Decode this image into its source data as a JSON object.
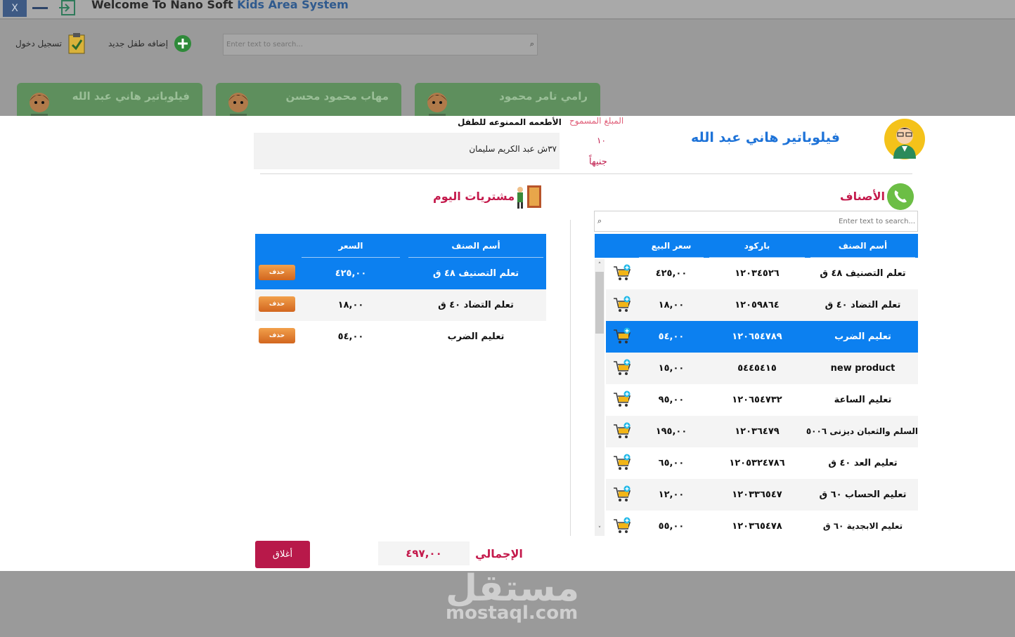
{
  "window": {
    "close_label": "X",
    "title_prefix": "Welcome To Nano Soft",
    "title_accent": "Kids Area System"
  },
  "toolbar": {
    "login_label": "تسجيل دخول",
    "add_child_label": "إضافه طفل جديد",
    "search_placeholder": "Enter text to search..."
  },
  "children_cards": [
    {
      "name": "فيلوباتير هاني عبد الله"
    },
    {
      "name": "مهاب محمود محسن"
    },
    {
      "name": "رامي تامر محمود"
    }
  ],
  "modal": {
    "child_name": "فيلوباتير  هاني عبد الله",
    "allowed_amount_label": "المبلغ المسموح",
    "allowed_amount_value": "١٠",
    "allowed_amount_currency": "جنيهاً",
    "forbidden_food_title": "الأطعمه الممنوعه للطفل",
    "forbidden_food_text": "٣٧ش عبد الكريم سليمان",
    "categories_title": "الأصناف",
    "purchases_title": "مشتريات اليوم",
    "categories_search_placeholder": "Enter text to search...",
    "categories_columns": {
      "name": "أسم الصنف",
      "barcode": "باركود",
      "price": "سعر البيع"
    },
    "categories": [
      {
        "name": "تعلم التصنيف ٤٨ ق",
        "barcode": "١٢٠٣٤٥٢٦",
        "price": "٤٢٥,٠٠",
        "selected": false
      },
      {
        "name": "تعلم التضاد ٤٠ ق",
        "barcode": "١٢٠٥٩٨٦٤",
        "price": "١٨,٠٠",
        "selected": false
      },
      {
        "name": "تعليم الضرب",
        "barcode": "١٢٠٦٥٤٧٨٩",
        "price": "٥٤,٠٠",
        "selected": true
      },
      {
        "name": "new product",
        "barcode": "٥٤٤٥٤١٥",
        "price": "١٥,٠٠",
        "selected": false
      },
      {
        "name": "تعليم الساعة",
        "barcode": "١٢٠٦٥٤٧٣٢",
        "price": "٩٥,٠٠",
        "selected": false
      },
      {
        "name": "السلم والثعبان ديزنى ٥٠٠٦",
        "barcode": "١٢٠٣٦٤٧٩",
        "price": "١٩٥,٠٠",
        "selected": false
      },
      {
        "name": "تعليم العد ٤٠ ق",
        "barcode": "١٢٠٥٣٢٤٧٨٦",
        "price": "٦٥,٠٠",
        "selected": false
      },
      {
        "name": "تعليم الحساب ٦٠ ق",
        "barcode": "١٢٠٣٣٦٥٤٧",
        "price": "١٢,٠٠",
        "selected": false
      },
      {
        "name": "تعليم الابجدية ٦٠ ق",
        "barcode": "١٢٠٣٦٥٤٧٨",
        "price": "٥٥,٠٠",
        "selected": false
      }
    ],
    "purchases_columns": {
      "name": "أسم الصنف",
      "price": "السعر"
    },
    "purchases": [
      {
        "name": "تعلم التصنيف ٤٨ ق",
        "price": "٤٢٥,٠٠",
        "delete_label": "حذف",
        "selected": true
      },
      {
        "name": "تعلم التضاد ٤٠ ق",
        "price": "١٨,٠٠",
        "delete_label": "حذف",
        "selected": false
      },
      {
        "name": "تعليم الضرب",
        "price": "٥٤,٠٠",
        "delete_label": "حذف",
        "selected": false
      }
    ],
    "total_label": "الإجمالي",
    "total_value": "٤٩٧,٠٠",
    "close_label": "أغلاق"
  },
  "watermark": {
    "arabic": "مستقل",
    "english": "mostaql.com"
  },
  "colors": {
    "accent_blue": "#0c80f0",
    "accent_red": "#c41a4c",
    "card_green": "#5e8f5d",
    "delete_orange": "#e2812f"
  }
}
